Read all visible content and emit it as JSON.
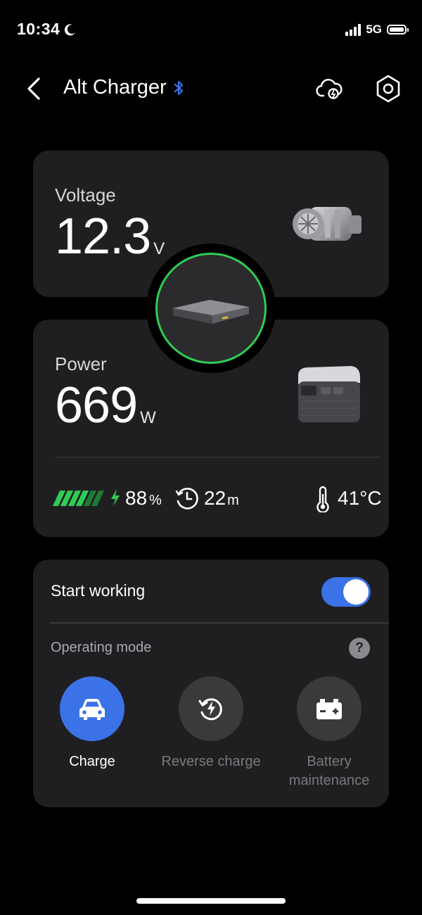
{
  "status_bar": {
    "time": "10:34",
    "network": "5G"
  },
  "header": {
    "title": "Alt Charger"
  },
  "voltage_card": {
    "label": "Voltage",
    "value": "12.3",
    "unit": "V"
  },
  "power_card": {
    "label": "Power",
    "value": "669",
    "unit": "W",
    "battery_percent": "88",
    "battery_percent_unit": "%",
    "time_remaining": "22",
    "time_unit": "m",
    "temperature": "41°C"
  },
  "control_card": {
    "start_working_label": "Start working",
    "start_working_on": true,
    "operating_mode_label": "Operating mode",
    "help_glyph": "?",
    "modes": [
      {
        "label": "Charge",
        "icon": "car-icon",
        "selected": true
      },
      {
        "label": "Reverse charge",
        "icon": "reverse-charge-icon",
        "selected": false
      },
      {
        "label": "Battery maintenance",
        "icon": "battery-icon",
        "selected": false
      }
    ]
  },
  "colors": {
    "accent": "#3b72e8",
    "green": "#2fcc55",
    "card": "#1f1f21"
  }
}
